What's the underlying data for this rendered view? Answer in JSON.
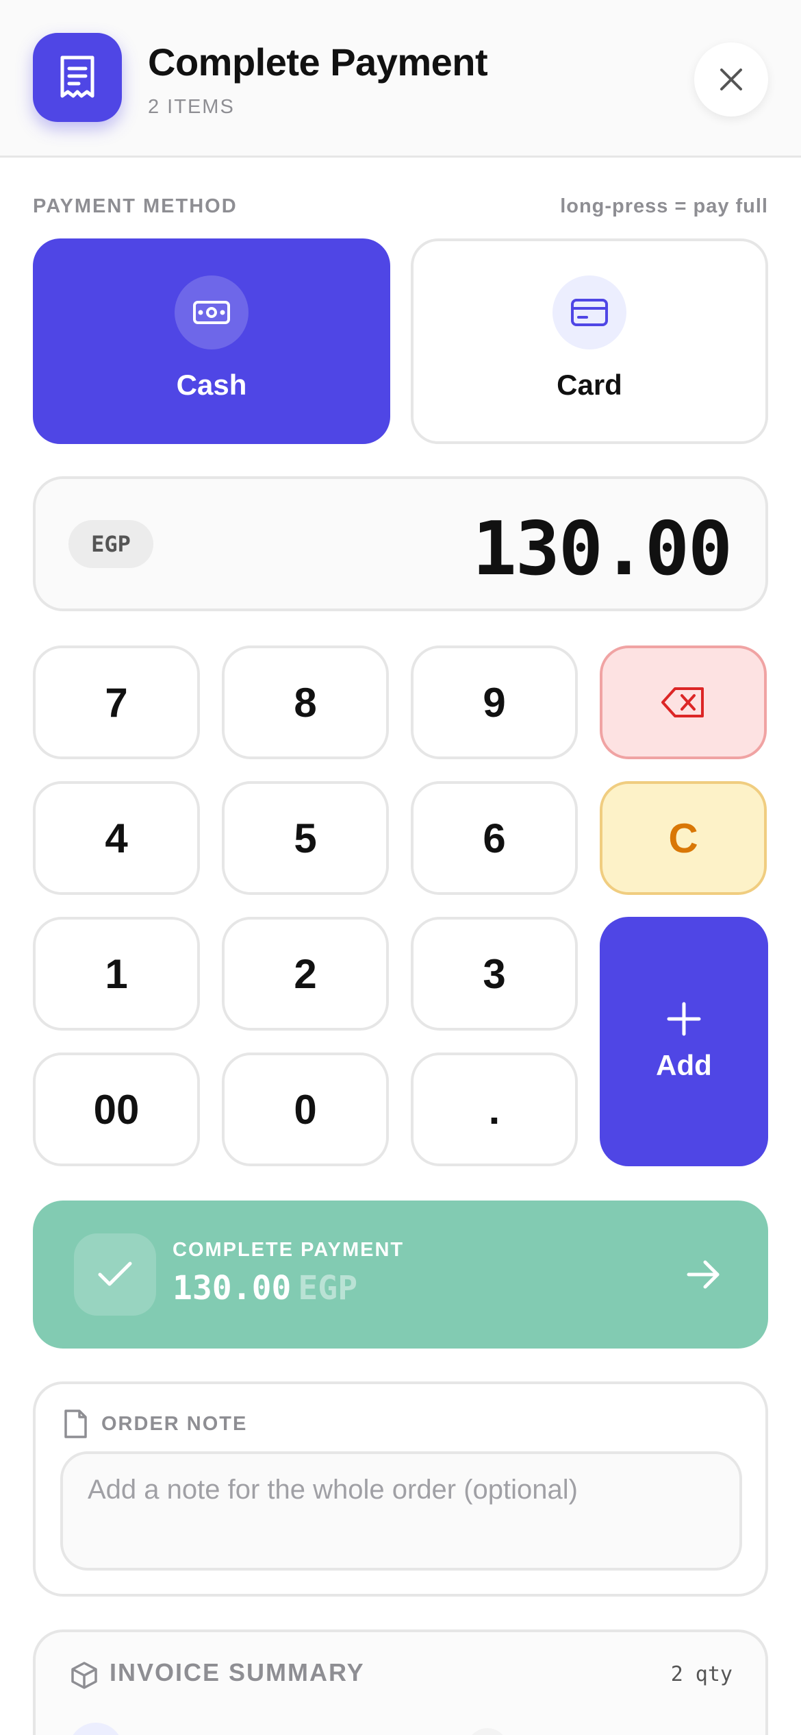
{
  "header": {
    "title": "Complete Payment",
    "subtitle": "2 ITEMS"
  },
  "payment": {
    "section_label": "PAYMENT METHOD",
    "hint": "long-press = pay full",
    "methods": [
      {
        "label": "Cash",
        "icon": "cash-icon",
        "selected": true
      },
      {
        "label": "Card",
        "icon": "credit-card-icon",
        "selected": false
      }
    ]
  },
  "amount": {
    "currency": "EGP",
    "value": "130.00"
  },
  "keypad": {
    "k7": "7",
    "k8": "8",
    "k9": "9",
    "k4": "4",
    "k5": "5",
    "k6": "6",
    "k1": "1",
    "k2": "2",
    "k3": "3",
    "k00": "00",
    "k0": "0",
    "kdot": ".",
    "clear": "C",
    "add": "Add"
  },
  "complete": {
    "label": "COMPLETE PAYMENT",
    "amount": "130.00",
    "currency": "EGP"
  },
  "note": {
    "label": "ORDER NOTE",
    "placeholder": "Add a note for the whole order (optional)",
    "value": ""
  },
  "summary": {
    "label": "INVOICE SUMMARY",
    "qty": "2 qty"
  },
  "colors": {
    "accent": "#4f46e5",
    "success": "#82cbb2",
    "danger_bg": "#fde2e2",
    "warning_bg": "#fdf2c8",
    "warning_text": "#d97706"
  }
}
